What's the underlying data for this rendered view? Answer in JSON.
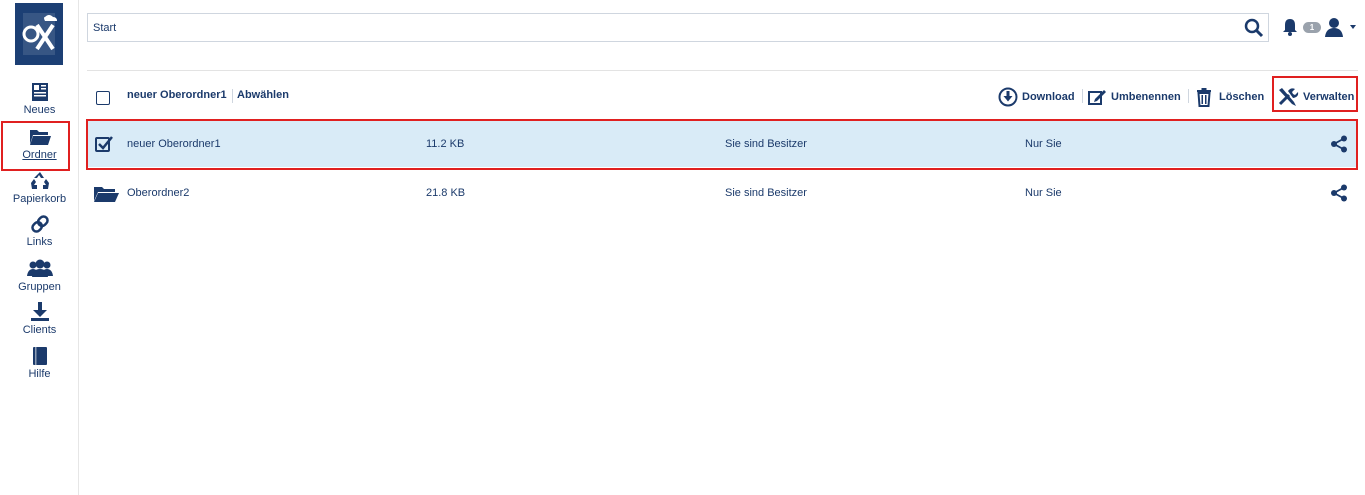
{
  "sidebar": {
    "logo": "logo-icon",
    "items": [
      {
        "id": "neues",
        "label": "Neues",
        "icon": "newspaper-icon"
      },
      {
        "id": "ordner",
        "label": "Ordner",
        "icon": "folder-icon",
        "active": true
      },
      {
        "id": "papierkorb",
        "label": "Papierkorb",
        "icon": "recycle-icon"
      },
      {
        "id": "links",
        "label": "Links",
        "icon": "link-icon"
      },
      {
        "id": "gruppen",
        "label": "Gruppen",
        "icon": "group-icon"
      },
      {
        "id": "clients",
        "label": "Clients",
        "icon": "download-icon"
      },
      {
        "id": "hilfe",
        "label": "Hilfe",
        "icon": "book-icon"
      }
    ]
  },
  "header": {
    "breadcrumb": "Start",
    "notification_count": "1"
  },
  "toolbar": {
    "selected_name": "neuer Oberordner1",
    "deselect_label": "Abwählen",
    "download_label": "Download",
    "rename_label": "Umbenennen",
    "delete_label": "Löschen",
    "manage_label": "Verwalten"
  },
  "files": [
    {
      "name": "neuer Oberordner1",
      "size": "11.2 KB",
      "owner": "Sie sind Besitzer",
      "access": "Nur Sie",
      "selected": true
    },
    {
      "name": "Oberordner2",
      "size": "21.8 KB",
      "owner": "Sie sind Besitzer",
      "access": "Nur Sie",
      "selected": false
    }
  ],
  "colors": {
    "primary": "#1b3a6b",
    "selected_row": "#d9ebf7",
    "highlight": "#e02020",
    "logo_bg": "#1c3f74"
  }
}
